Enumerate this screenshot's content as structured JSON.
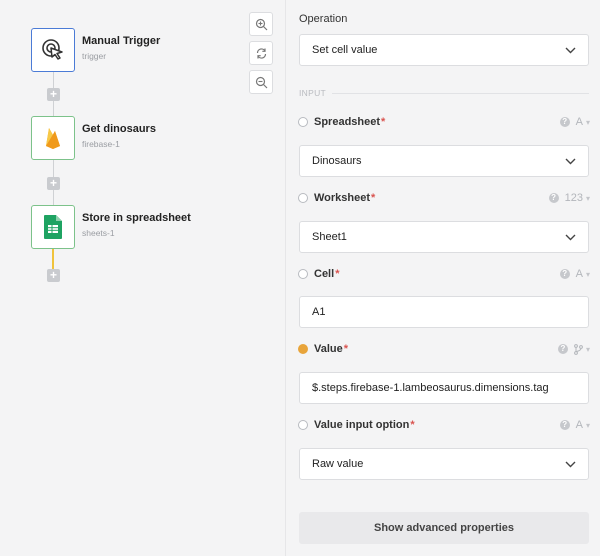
{
  "flow": {
    "nodes": [
      {
        "title": "Manual Trigger",
        "subtitle": "trigger",
        "icon": "cursor-click-icon"
      },
      {
        "title": "Get dinosaurs",
        "subtitle": "firebase-1",
        "icon": "firebase-icon"
      },
      {
        "title": "Store in spreadsheet",
        "subtitle": "sheets-1",
        "icon": "google-sheets-icon"
      }
    ],
    "add_glyph": "+"
  },
  "zoom_controls": [
    "zoom-in-icon",
    "refresh-icon",
    "zoom-out-icon"
  ],
  "panel": {
    "operation_label": "Operation",
    "operation_value": "Set cell value",
    "section_title": "INPUT",
    "required_mark": "*",
    "fields": [
      {
        "label": "Spreadsheet",
        "type_tag": "A",
        "value": "Dinosaurs",
        "dropdown": true,
        "radio_filled": false
      },
      {
        "label": "Worksheet",
        "type_tag": "123",
        "value": "Sheet1",
        "dropdown": true,
        "radio_filled": false
      },
      {
        "label": "Cell",
        "type_tag": "A",
        "value": "A1",
        "dropdown": false,
        "radio_filled": false
      },
      {
        "label": "Value",
        "type_tag": "",
        "value": "$.steps.firebase-1.lambeosaurus.dimensions.tag",
        "dropdown": false,
        "radio_filled": true
      },
      {
        "label": "Value input option",
        "type_tag": "A",
        "value": "Raw value",
        "dropdown": true,
        "radio_filled": false
      }
    ],
    "advanced_button": "Show advanced properties"
  },
  "colors": {
    "trigger_border": "#4b7bd6",
    "node_border": "#7cc28a",
    "active_connector": "#f0c33c",
    "radio_active": "#e8a43a",
    "required": "#d9534f"
  }
}
